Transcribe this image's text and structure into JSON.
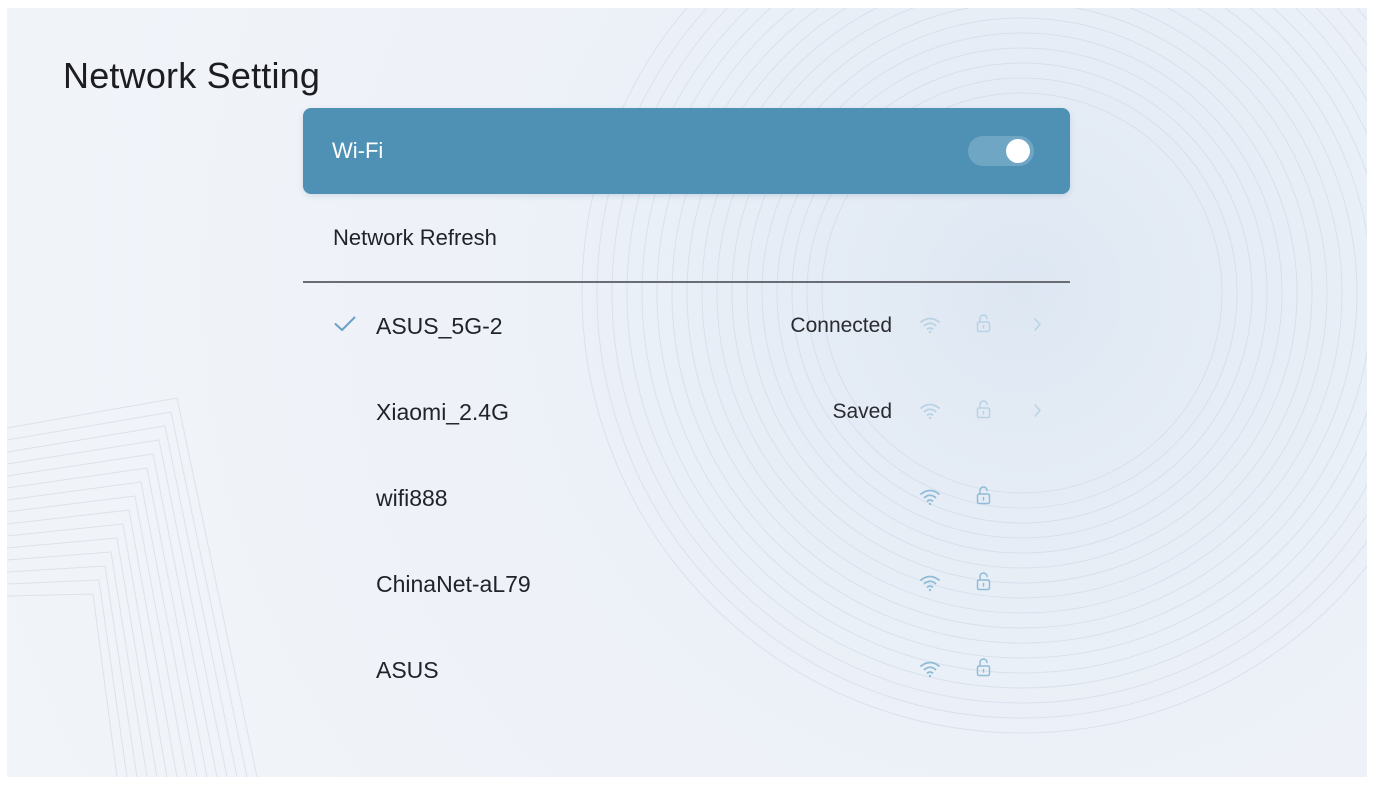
{
  "page": {
    "title": "Network Setting"
  },
  "wifi": {
    "label": "Wi-Fi",
    "enabled": true
  },
  "refresh": {
    "label": "Network Refresh"
  },
  "networks": [
    {
      "name": "ASUS_5G-2",
      "status": "Connected",
      "connected": true,
      "secured": true,
      "has_details": true
    },
    {
      "name": "Xiaomi_2.4G",
      "status": "Saved",
      "connected": false,
      "secured": true,
      "has_details": true
    },
    {
      "name": "wifi888",
      "status": "",
      "connected": false,
      "secured": true,
      "has_details": false
    },
    {
      "name": "ChinaNet-aL79",
      "status": "",
      "connected": false,
      "secured": true,
      "has_details": false
    },
    {
      "name": "ASUS",
      "status": "",
      "connected": false,
      "secured": true,
      "has_details": false
    }
  ],
  "icons": {
    "check": "check-icon",
    "signal": "wifi-signal-icon",
    "lock": "lock-icon",
    "chevron": "chevron-right-icon"
  },
  "colors": {
    "accent": "#4f91b5",
    "icon_dim": "#b9d3e4",
    "icon_bright": "#90bcd8",
    "check": "#6ba0c6"
  }
}
